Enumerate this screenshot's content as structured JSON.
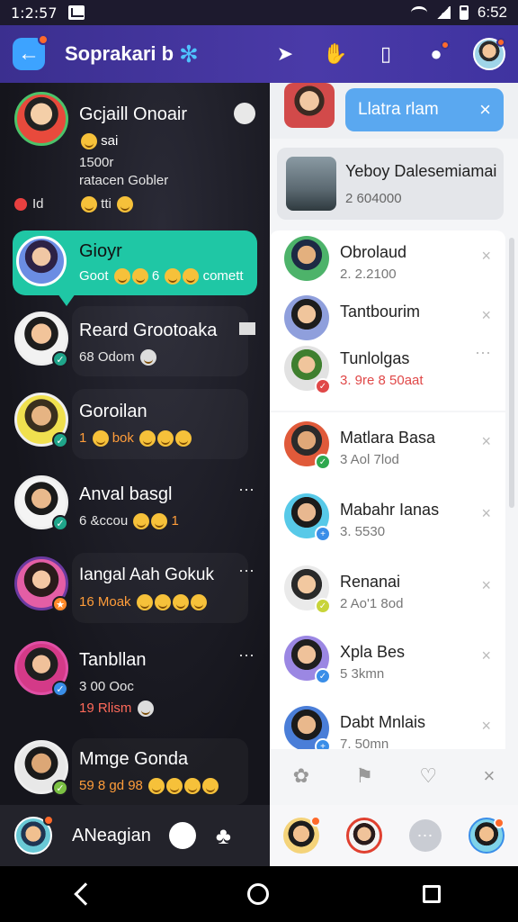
{
  "status_bar": {
    "time": "1:2:57",
    "right_time": "6:52"
  },
  "app_bar": {
    "title": "Soprakari b"
  },
  "left_chats": [
    {
      "name": "Gcjaill Onoair",
      "line1": "1500r",
      "line2": "ratacen Gobler",
      "line3": "Id",
      "line3b": "tti"
    },
    {
      "name": "Gioyr",
      "sub": "Goot",
      "sub2": "6",
      "sub3": "comett"
    },
    {
      "name": "Reard Grootoaka",
      "sub": "68 Odom"
    },
    {
      "name": "Goroilan",
      "sub": "1",
      "sub2": "bok"
    },
    {
      "name": "Anval basgl",
      "sub": "6 &ccou",
      "sub2": "1"
    },
    {
      "name": "Iangal Aah Gokuk",
      "sub": "16 Moak"
    },
    {
      "name": "Tanbllan",
      "sub": "3 00 Ooc",
      "sub2": "19 Rlism"
    },
    {
      "name": "Mmge Gonda",
      "sub": "59 8 gd 98"
    }
  ],
  "bottom_left": {
    "name": "ANeagian"
  },
  "right_top": {
    "pill": "Llatra rlam"
  },
  "featured": {
    "title": "Yeboy Dalesemiamai",
    "sub": "2 604000"
  },
  "right_list": [
    {
      "name": "Obrolaud",
      "meta": "2. 2.2100",
      "red": false
    },
    {
      "name": "Tantbourim",
      "meta": "",
      "red": false
    },
    {
      "name": "Tunlolgas",
      "meta": "3. 9re 8 50aat",
      "red": true
    },
    {
      "name": "Matlara Basa",
      "meta": "3 Aol 7lod",
      "red": false
    },
    {
      "name": "Mabahr Ianas",
      "meta": "3. 5530",
      "red": false
    },
    {
      "name": "Renanai",
      "meta": "2 Ao'1 8od",
      "red": false
    },
    {
      "name": "Xpla Bes",
      "meta": "5 3kmn",
      "red": false
    },
    {
      "name": "Dabt Mnlais",
      "meta": "7. 50mn",
      "red": false
    }
  ],
  "colors": {
    "accent": "#1fc7a5",
    "bar": "#3b2f8f",
    "pill": "#5aa8f0"
  }
}
